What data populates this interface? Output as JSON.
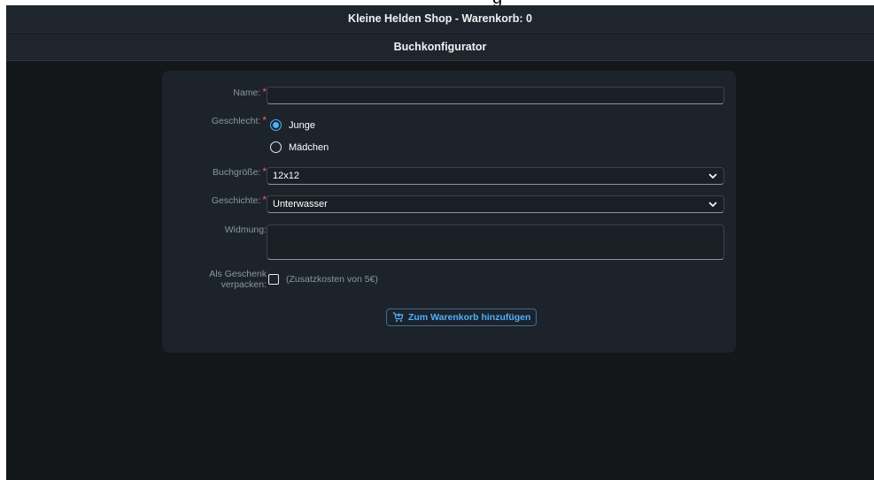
{
  "shell": {
    "title": "Kleine Helden Shop - Warenkorb: 0"
  },
  "page": {
    "title": "Buchkonfigurator"
  },
  "form": {
    "name": {
      "label": "Name:",
      "value": "",
      "required_mark": "*"
    },
    "gender": {
      "label": "Geschlecht:",
      "required_mark": "*",
      "options": [
        {
          "label": "Junge",
          "selected": true
        },
        {
          "label": "Mädchen",
          "selected": false
        }
      ]
    },
    "book_size": {
      "label": "Buchgröße:",
      "value": "12x12",
      "required_mark": "*"
    },
    "story": {
      "label": "Geschichte:",
      "value": "Unterwasser",
      "required_mark": "*"
    },
    "dedication": {
      "label": "Widmung:",
      "value": ""
    },
    "gift_wrap": {
      "label_line1": "Als Geschenk",
      "label_line2": "verpacken:",
      "option_label": "(Zusatzkosten von 5€)",
      "checked": false
    },
    "add_to_cart": {
      "label": "Zum Warenkorb hinzufügen",
      "icon": "cart-add-icon"
    }
  },
  "colors": {
    "accent": "#4db1ff",
    "required": "#ff5a5a",
    "background": "#14171a",
    "card": "#1d232a"
  }
}
